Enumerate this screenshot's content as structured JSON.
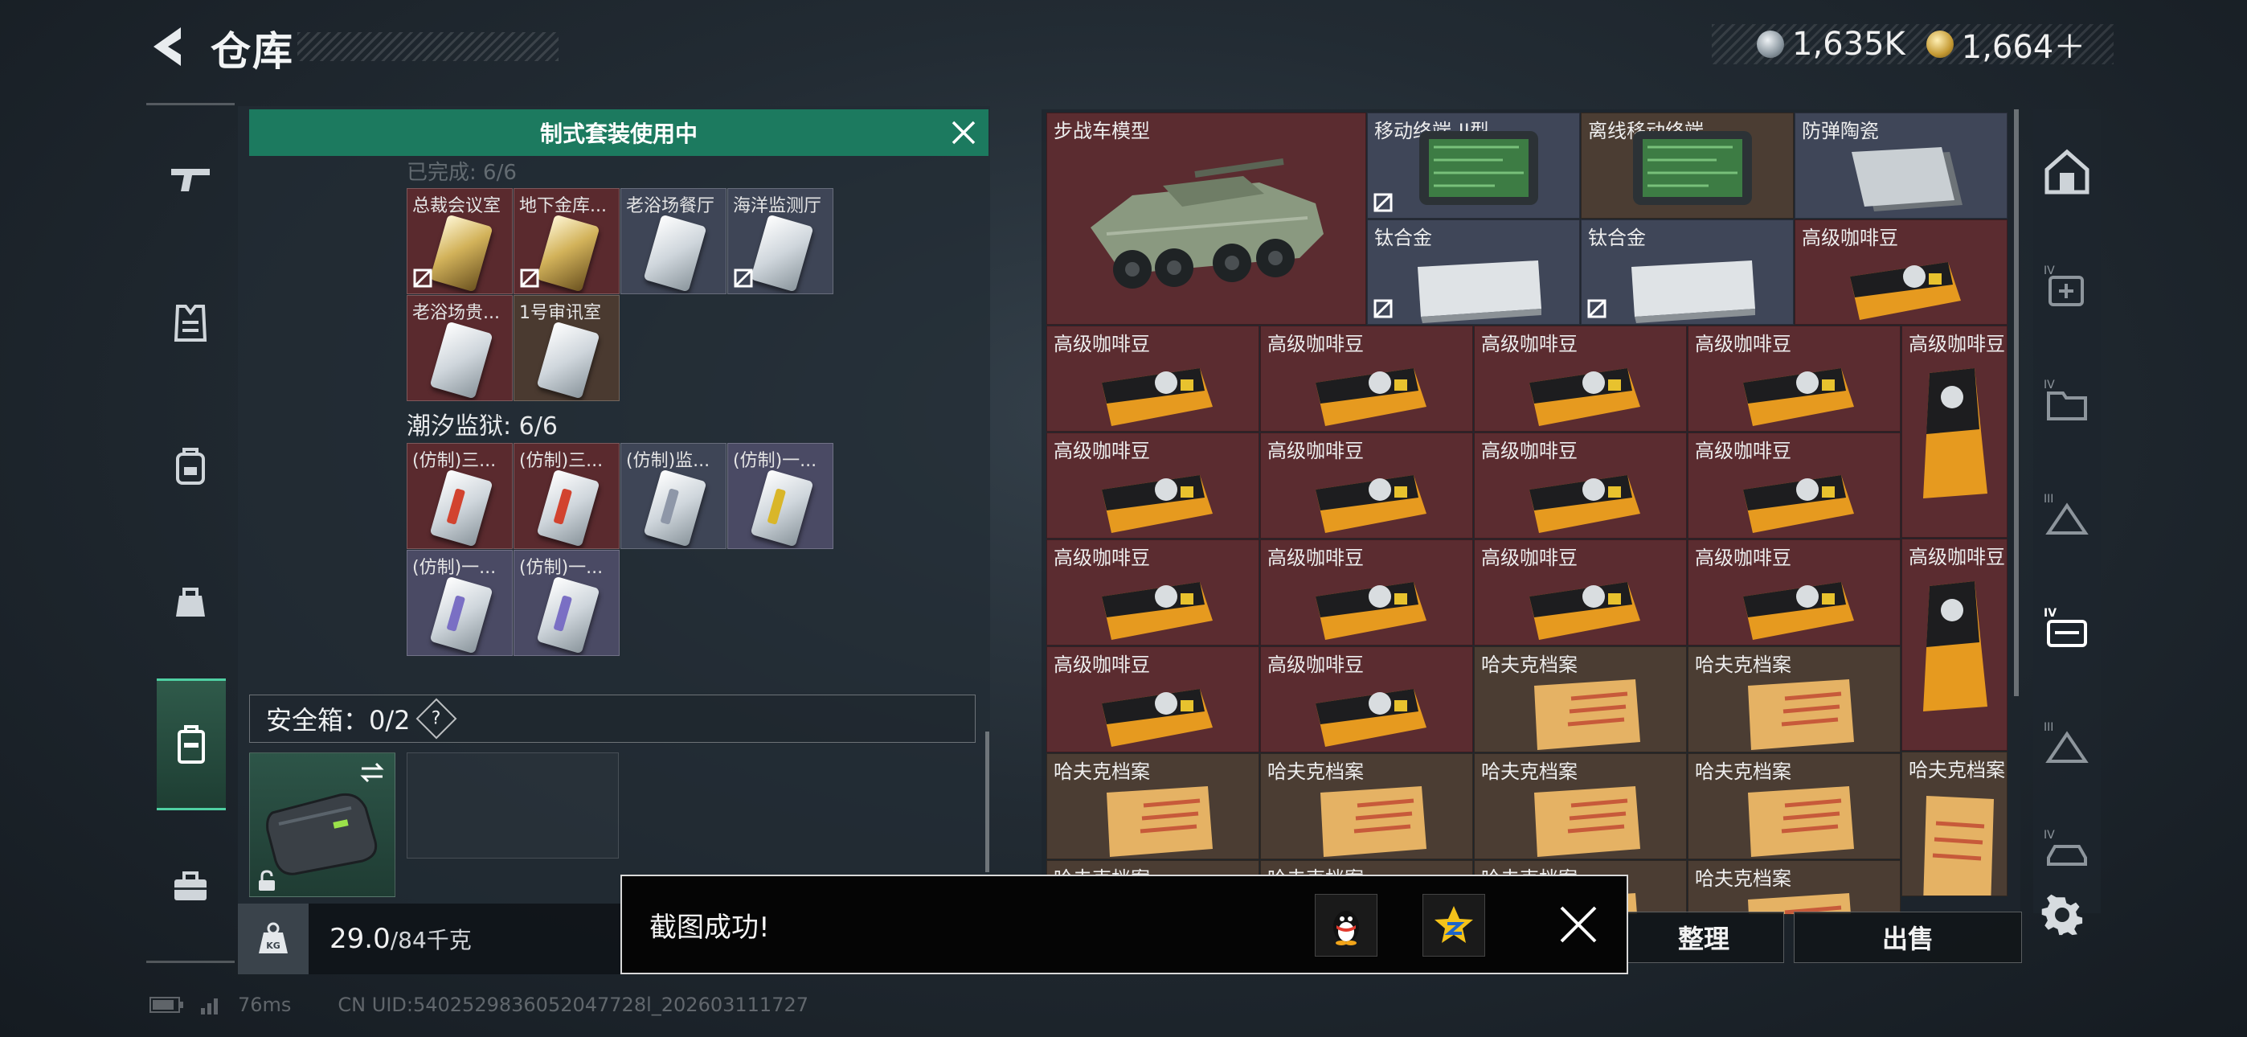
{
  "header": {
    "title": "仓库",
    "currency": [
      {
        "name": "silver-coin-icon",
        "value": "1,635K"
      },
      {
        "name": "gold-coin-icon",
        "value": "1,664＋"
      }
    ]
  },
  "left_panel": {
    "banner": "制式套装使用中",
    "faded_count": "已完成: 6/6",
    "group1_cards": [
      {
        "label": "总裁会议室",
        "color": "red",
        "card": "gold",
        "locked": true
      },
      {
        "label": "地下金库...",
        "color": "red",
        "card": "gold",
        "locked": true
      },
      {
        "label": "老浴场餐厅",
        "color": "gray",
        "card": "silver",
        "locked": false
      },
      {
        "label": "海洋监测厅",
        "color": "gray",
        "card": "silver",
        "locked": true
      },
      {
        "label": "老浴场贵...",
        "color": "red",
        "card": "silver",
        "locked": false
      },
      {
        "label": "1号审讯室",
        "color": "brown",
        "card": "silver",
        "locked": false
      }
    ],
    "group2_title": "潮汐监狱: 6/6",
    "group2_cards": [
      {
        "label": "(仿制)三...",
        "color": "red",
        "stripe": "#d2432f"
      },
      {
        "label": "(仿制)三...",
        "color": "red",
        "stripe": "#d2432f"
      },
      {
        "label": "(仿制)监...",
        "color": "gray",
        "stripe": "#8e97a8"
      },
      {
        "label": "(仿制)一...",
        "color": "purple",
        "stripe": "#d9b629"
      },
      {
        "label": "(仿制)一...",
        "color": "purple",
        "stripe": "#7a6fc4"
      },
      {
        "label": "(仿制)一...",
        "color": "purple",
        "stripe": "#7a6fc4"
      }
    ],
    "safe_label": "安全箱：0/2",
    "safe_help": "?",
    "weight_value": "29.0",
    "weight_limit": "/84千克",
    "kg_icon": "KG"
  },
  "stash": {
    "items": {
      "ifv": "步战车模型",
      "terminal2": "移动终端-II型",
      "offline_terminal": "离线移动终端",
      "ceramic": "防弹陶瓷",
      "titanium1": "钛合金",
      "titanium2": "钛合金",
      "coffee": "高级咖啡豆",
      "hafk": "哈夫克档案"
    },
    "coffee_grid": [
      [
        "高级咖啡豆",
        "高级咖啡豆",
        "高级咖啡豆",
        "高级咖啡豆"
      ],
      [
        "高级咖啡豆",
        "高级咖啡豆",
        "高级咖啡豆",
        "高级咖啡豆"
      ],
      [
        "高级咖啡豆",
        "高级咖啡豆",
        "高级咖啡豆",
        "高级咖啡豆"
      ],
      [
        "高级咖啡豆",
        "高级咖啡豆",
        "哈夫克档案",
        "哈夫克档案"
      ],
      [
        "哈夫克档案",
        "哈夫克档案",
        "哈夫克档案",
        "哈夫克档案"
      ]
    ],
    "bottom_partial": [
      "哈夫克档案",
      "哈夫克档案",
      "哈夫克档案",
      "哈夫克档案"
    ],
    "tall_coffee_1": "高级咖啡豆",
    "tall_coffee_2": "高级咖啡豆",
    "tall_file": "哈夫克档案"
  },
  "buttons": {
    "organize": "整理",
    "sell": "出售"
  },
  "toast": {
    "message": "截图成功!",
    "qq_icon": "qq-penguin-icon",
    "qzone_icon": "qzone-star-icon"
  },
  "footer": {
    "ping": "76ms",
    "uid": "CN UID:5402529836052047728l_202603111727"
  },
  "colors": {
    "accent_green": "#1c7a5f",
    "rarity_red": "#5b2c30",
    "rarity_gray": "#3f4658",
    "rarity_brown": "#4b3d33"
  }
}
